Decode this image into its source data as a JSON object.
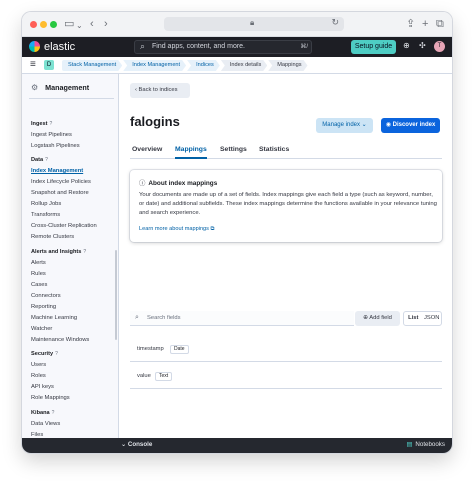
{
  "browser": {
    "url": ""
  },
  "header": {
    "brand": "elastic",
    "search_placeholder": "Find apps, content, and more.",
    "search_shortcut": "⌘/",
    "setup_label": "Setup guide",
    "avatar_initial": "T",
    "space_initial": "D"
  },
  "breadcrumbs": [
    "Stack Management",
    "Index Management",
    "Indices",
    "Index details",
    "Mappings"
  ],
  "sidebar": {
    "title": "Management",
    "groups": [
      {
        "label": "Ingest",
        "items": [
          "Ingest Pipelines",
          "Logstash Pipelines"
        ]
      },
      {
        "label": "Data",
        "items": [
          "Index Management",
          "Index Lifecycle Policies",
          "Snapshot and Restore",
          "Rollup Jobs",
          "Transforms",
          "Cross-Cluster Replication",
          "Remote Clusters"
        ]
      },
      {
        "label": "Alerts and Insights",
        "items": [
          "Alerts",
          "Rules",
          "Cases",
          "Connectors",
          "Reporting",
          "Machine Learning",
          "Watcher",
          "Maintenance Windows"
        ]
      },
      {
        "label": "Security",
        "items": [
          "Users",
          "Roles",
          "API keys",
          "Role Mappings"
        ]
      },
      {
        "label": "Kibana",
        "items": [
          "Data Views",
          "Files"
        ]
      }
    ],
    "active_item": "Index Management"
  },
  "main": {
    "back_label": "Back to indices",
    "title": "falogins",
    "manage_label": "Manage index",
    "discover_label": "Discover index",
    "tabs": [
      "Overview",
      "Mappings",
      "Settings",
      "Statistics"
    ],
    "active_tab": "Mappings",
    "callout": {
      "title": "About index mappings",
      "text": "Your documents are made up of a set of fields. Index mappings give each field a type (such as keyword, number, or date) and additional subfields. These index mappings determine the functions available in your relevance tuning and search experience.",
      "link": "Learn more about mappings"
    },
    "search_placeholder": "Search fields",
    "add_field_label": "Add field",
    "view_toggle": [
      "List",
      "JSON"
    ],
    "fields": [
      {
        "name": "timestamp",
        "type": "Date"
      },
      {
        "name": "value",
        "type": "Text"
      }
    ]
  },
  "footer": {
    "console_label": "Console",
    "notebooks_label": "Notebooks"
  },
  "colors": {
    "accent": "#0b64dd",
    "header_bg": "#1d1e24",
    "setup_bg": "#4ecdc4"
  }
}
